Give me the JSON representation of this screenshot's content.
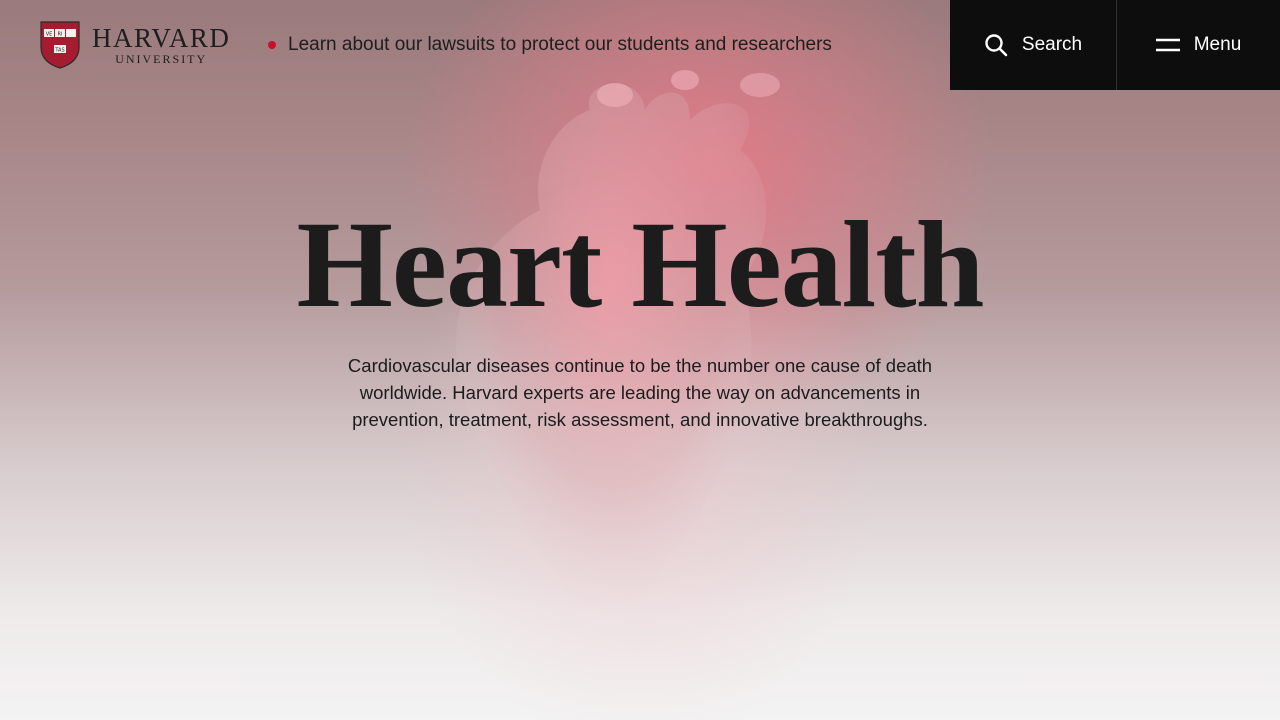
{
  "header": {
    "logo": {
      "wordmark_main": "HARVARD",
      "wordmark_sub": "UNIVERSITY",
      "shield_motto": [
        "VE",
        "RI",
        "TAS"
      ]
    },
    "alert_text": "Learn about our lawsuits to protect our students and researchers",
    "search_label": "Search",
    "menu_label": "Menu"
  },
  "hero": {
    "title": "Heart Health",
    "description": "Cardiovascular diseases continue to be the number one cause of death worldwide. Harvard experts are leading the way on advancements in prevention, treatment, risk assessment, and innovative breakthroughs."
  },
  "colors": {
    "crimson": "#a51c30",
    "alert_dot": "#c8102e",
    "nav_bg": "#0d0d0d",
    "text": "#1c1c1c"
  },
  "icons": [
    "harvard-shield-icon",
    "search-icon",
    "menu-icon"
  ]
}
